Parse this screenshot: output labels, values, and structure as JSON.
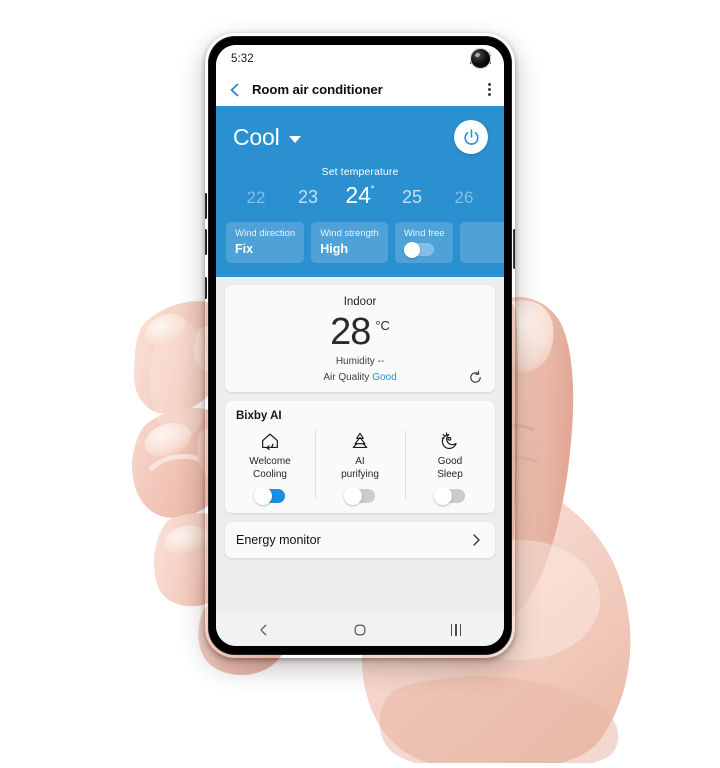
{
  "status_bar": {
    "time": "5:32",
    "icons": [
      "signal-icon",
      "battery-icon",
      "front-camera"
    ]
  },
  "app_bar": {
    "back_icon": "back-chevron-icon",
    "title": "Room air conditioner",
    "more_icon": "more-options-icon"
  },
  "control_panel": {
    "accent_color": "#2b90d0",
    "mode": "Cool",
    "mode_caret": "chevron-down-icon",
    "power_icon": "power-icon",
    "set_temperature_label": "Set temperature",
    "temperatures": [
      {
        "value": "22",
        "state": "far"
      },
      {
        "value": "23",
        "state": "near"
      },
      {
        "value": "24",
        "state": "selected",
        "degree": "˚"
      },
      {
        "value": "25",
        "state": "near"
      },
      {
        "value": "26",
        "state": "far"
      }
    ],
    "wind_cards": [
      {
        "label": "Wind direction",
        "value": "Fix",
        "type": "value"
      },
      {
        "label": "Wind strength",
        "value": "High",
        "type": "value"
      },
      {
        "label": "Wind free",
        "value": "",
        "type": "toggle",
        "on": false
      }
    ]
  },
  "indoor_card": {
    "title": "Indoor",
    "temperature": "28",
    "unit": "°C",
    "humidity": "Humidity --",
    "air_quality_label": "Air Quality",
    "air_quality_value": "Good",
    "air_quality_color": "#2b90d0",
    "refresh_icon": "refresh-icon"
  },
  "bixby_card": {
    "title": "Bixby AI",
    "items": [
      {
        "icon": "welcome-cooling-icon",
        "label": "Welcome\nCooling",
        "on": true
      },
      {
        "icon": "ai-purifying-icon",
        "label": "AI\npurifying",
        "on": false
      },
      {
        "icon": "good-sleep-icon",
        "label": "Good\nSleep",
        "on": false
      }
    ]
  },
  "energy_card": {
    "label": "Energy monitor",
    "chevron_icon": "chevron-right-icon"
  },
  "nav_bar": {
    "back_icon": "nav-back-icon",
    "home_icon": "nav-home-icon",
    "recents_icon": "nav-recents-icon"
  }
}
